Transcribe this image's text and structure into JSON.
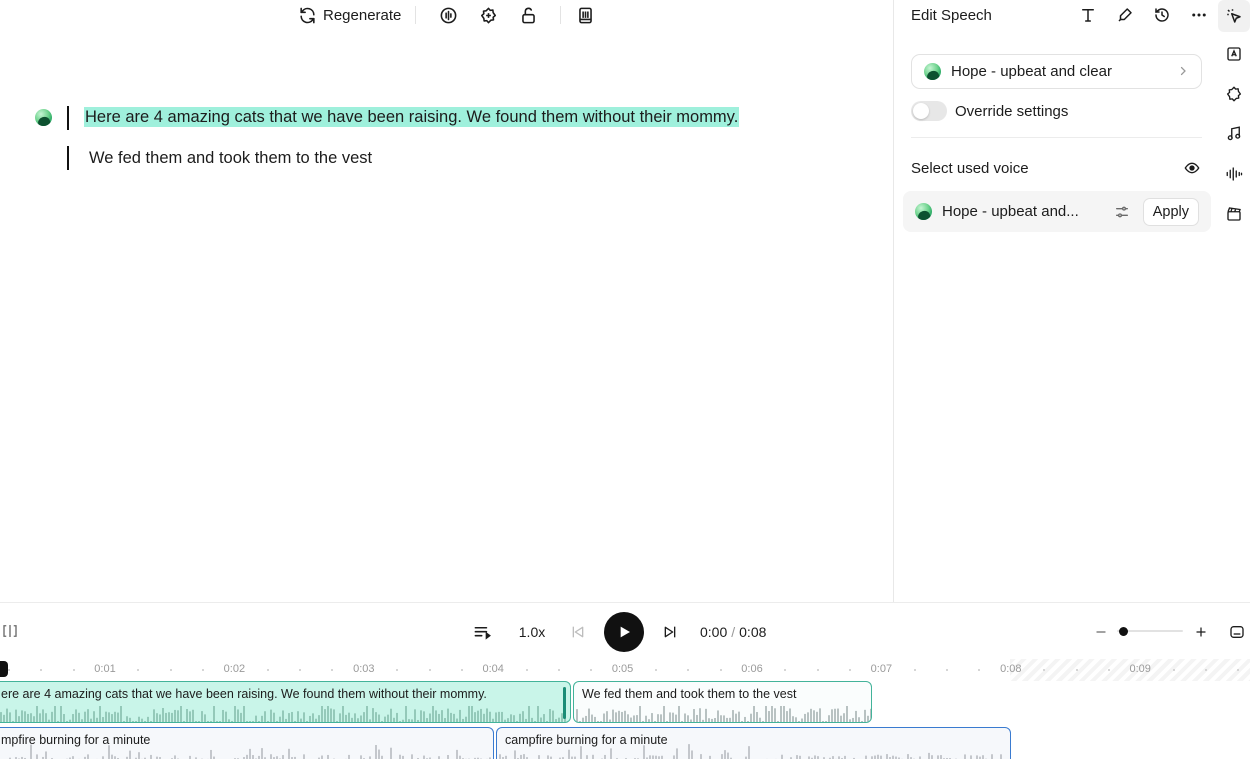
{
  "toolbar": {
    "regenerate_label": "Regenerate",
    "icons": [
      "regenerate-icon",
      "voice-enhance-icon",
      "sparkle-badge-icon",
      "unlock-icon",
      "book-icon"
    ]
  },
  "editor": {
    "paragraphs": [
      {
        "text": "Here are 4 amazing cats that we have been raising. We found them without their mommy.",
        "highlighted": true
      },
      {
        "text": "We fed them and took them to the vest",
        "highlighted": false
      }
    ]
  },
  "panel": {
    "title": "Edit Speech",
    "voice_name": "Hope - upbeat and clear",
    "override_label": "Override settings",
    "override_on": false,
    "used_voice_label": "Select used voice",
    "used_voice_name": "Hope - upbeat and...",
    "apply_label": "Apply"
  },
  "player": {
    "speed": "1.0x",
    "current_time": "0:00",
    "time_separator": "/",
    "total_time": "0:08",
    "zoom_level": 0.1
  },
  "timeline": {
    "ticks": [
      "0:01",
      "0:02",
      "0:03",
      "0:04",
      "0:05",
      "0:06",
      "0:07",
      "0:08",
      "0:09"
    ],
    "speech_clips": [
      "ere are 4 amazing cats that we have been raising. We found them without their mommy.",
      "We fed them and took them to the vest"
    ],
    "sfx_clips": [
      "mpfire burning for a minute",
      "campfire burning for a minute"
    ]
  },
  "colors": {
    "highlight": "#9ff0dc",
    "speech_clip": "#c9f5e9",
    "speech_border": "#43b39a",
    "sfx_border": "#3a7bd0"
  }
}
